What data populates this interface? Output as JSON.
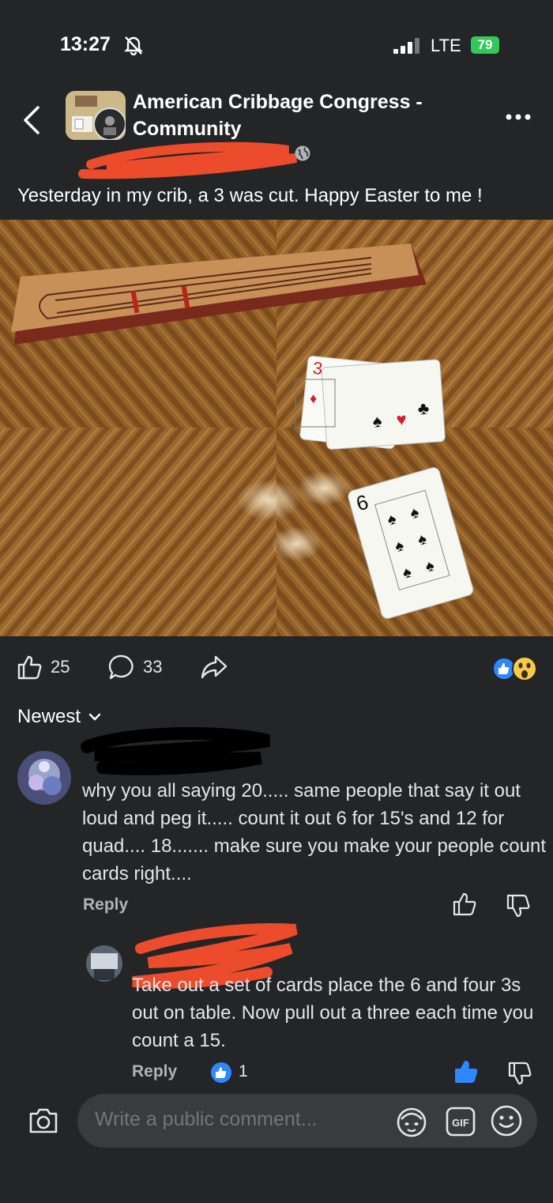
{
  "status_bar": {
    "time": "13:27",
    "network": "LTE",
    "battery": "79",
    "icons": [
      "bell-slash-icon",
      "signal-icon",
      "battery-icon"
    ]
  },
  "header": {
    "group_name": "American Cribbage Congress - Community",
    "icons": [
      "back-chevron-icon",
      "more-icon",
      "globe-icon"
    ]
  },
  "post": {
    "text": "Yesterday in my crib, a 3 was cut. Happy Easter to me !",
    "like_count": "25",
    "comment_count": "33"
  },
  "sort": {
    "label": "Newest"
  },
  "comments": [
    {
      "text": "why you all saying 20..... same people that say it out loud and peg it..... count it out 6 for 15's and 12 for quad.... 18....... make sure you make your people count cards right....",
      "reply_label": "Reply"
    },
    {
      "text": "Take out a set of cards place the 6 and four 3s out on table. Now pull out a three each time you count a 15.",
      "reply_label": "Reply",
      "like_count": "1"
    }
  ],
  "composer": {
    "placeholder": "Write a public comment..."
  },
  "colors": {
    "background": "#242526",
    "accent_blue": "#2d88ff",
    "redaction_red": "#ec4c2c",
    "battery_green": "#34c759"
  }
}
